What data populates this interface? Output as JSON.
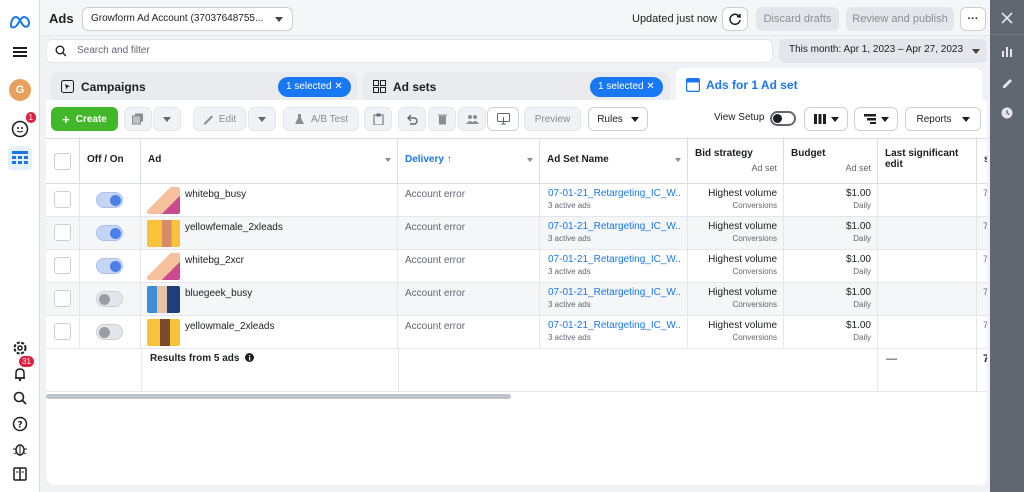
{
  "app": {
    "title": "Ads"
  },
  "account": {
    "label": "Growform Ad Account (37037648755..."
  },
  "status": {
    "updated": "Updated just now"
  },
  "buttons": {
    "discard": "Discard drafts",
    "publish": "Review and publish",
    "more": "···"
  },
  "search": {
    "placeholder": "Search and filter"
  },
  "date_range": "This month: Apr 1, 2023 – Apr 27, 2023",
  "left_rail": {
    "avatar_letter": "G",
    "notif_badge": "1",
    "bell_badge": "31"
  },
  "tabs": [
    {
      "label": "Campaigns",
      "pill": "1 selected  ✕"
    },
    {
      "label": "Ad sets",
      "pill": "1 selected  ✕"
    },
    {
      "label": "Ads for 1 Ad set"
    }
  ],
  "toolbar": {
    "create": "Create",
    "edit": "Edit",
    "ab_test": "A/B Test",
    "preview": "Preview",
    "rules": "Rules",
    "view_setup": "View Setup",
    "reports": "Reports"
  },
  "columns": {
    "off_on": "Off / On",
    "ad": "Ad",
    "delivery": "Delivery ↑",
    "adset_name": "Ad Set Name",
    "bid_strategy": "Bid strategy",
    "bid_sub": "Ad set",
    "budget": "Budget",
    "budget_sub": "Ad set",
    "last_edit": "Last significant edit",
    "next_col": "s"
  },
  "rows": [
    {
      "on": true,
      "name": "whitebg_busy",
      "delivery": "Account error",
      "adset": "07-01-21_Retargeting_IC_W...",
      "adset_sub": "3 active ads",
      "bid": "Highest volume",
      "bid_sub": "Conversions",
      "budget": "$1.00",
      "budget_sub": "Daily",
      "trunc": "7"
    },
    {
      "on": true,
      "name": "yellowfemale_2xleads",
      "delivery": "Account error",
      "adset": "07-01-21_Retargeting_IC_W...",
      "adset_sub": "3 active ads",
      "bid": "Highest volume",
      "bid_sub": "Conversions",
      "budget": "$1.00",
      "budget_sub": "Daily",
      "trunc": "7"
    },
    {
      "on": true,
      "name": "whitebg_2xcr",
      "delivery": "Account error",
      "adset": "07-01-21_Retargeting_IC_W...",
      "adset_sub": "3 active ads",
      "bid": "Highest volume",
      "bid_sub": "Conversions",
      "budget": "$1.00",
      "budget_sub": "Daily",
      "trunc": "7"
    },
    {
      "on": false,
      "name": "bluegeek_busy",
      "delivery": "Account error",
      "adset": "07-01-21_Retargeting_IC_W...",
      "adset_sub": "3 active ads",
      "bid": "Highest volume",
      "bid_sub": "Conversions",
      "budget": "$1.00",
      "budget_sub": "Daily",
      "trunc": "7"
    },
    {
      "on": false,
      "name": "yellowmale_2xleads",
      "delivery": "Account error",
      "adset": "07-01-21_Retargeting_IC_W...",
      "adset_sub": "3 active ads",
      "bid": "Highest volume",
      "bid_sub": "Conversions",
      "budget": "$1.00",
      "budget_sub": "Daily",
      "trunc": "7"
    }
  ],
  "results": {
    "label": "Results from 5 ads",
    "last_edit": "—",
    "trunc": "7"
  },
  "colors": {
    "accent": "#1877f2",
    "create_green": "#42b72a",
    "badge_red": "#e41e3f"
  },
  "icons": [
    "meta-logo-icon",
    "menu-icon",
    "campaign-icon",
    "adset-grid-icon",
    "ad-icon",
    "search-icon",
    "refresh-icon",
    "gear-icon",
    "bell-icon",
    "help-icon",
    "bug-icon",
    "book-icon",
    "close-icon",
    "chart-icon",
    "pencil-icon",
    "clock-icon"
  ]
}
